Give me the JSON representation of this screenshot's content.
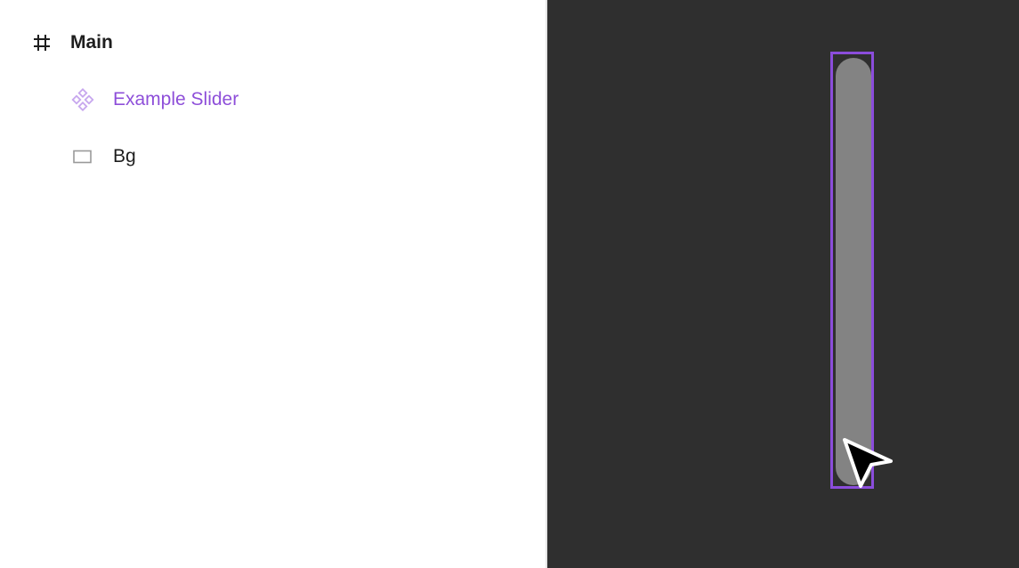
{
  "layers": {
    "frame": {
      "label": "Main",
      "icon": "frame-hash-icon"
    },
    "component": {
      "label": "Example Slider",
      "icon": "component-diamond-icon",
      "color": "#8e4fd9"
    },
    "rect": {
      "label": "Bg",
      "icon": "rectangle-icon"
    }
  },
  "canvas": {
    "background": "#2f2f2f",
    "selection_color": "#8b4ddb",
    "slider_track_color": "#838383",
    "cursor_icon": "pointer-arrow-icon"
  }
}
